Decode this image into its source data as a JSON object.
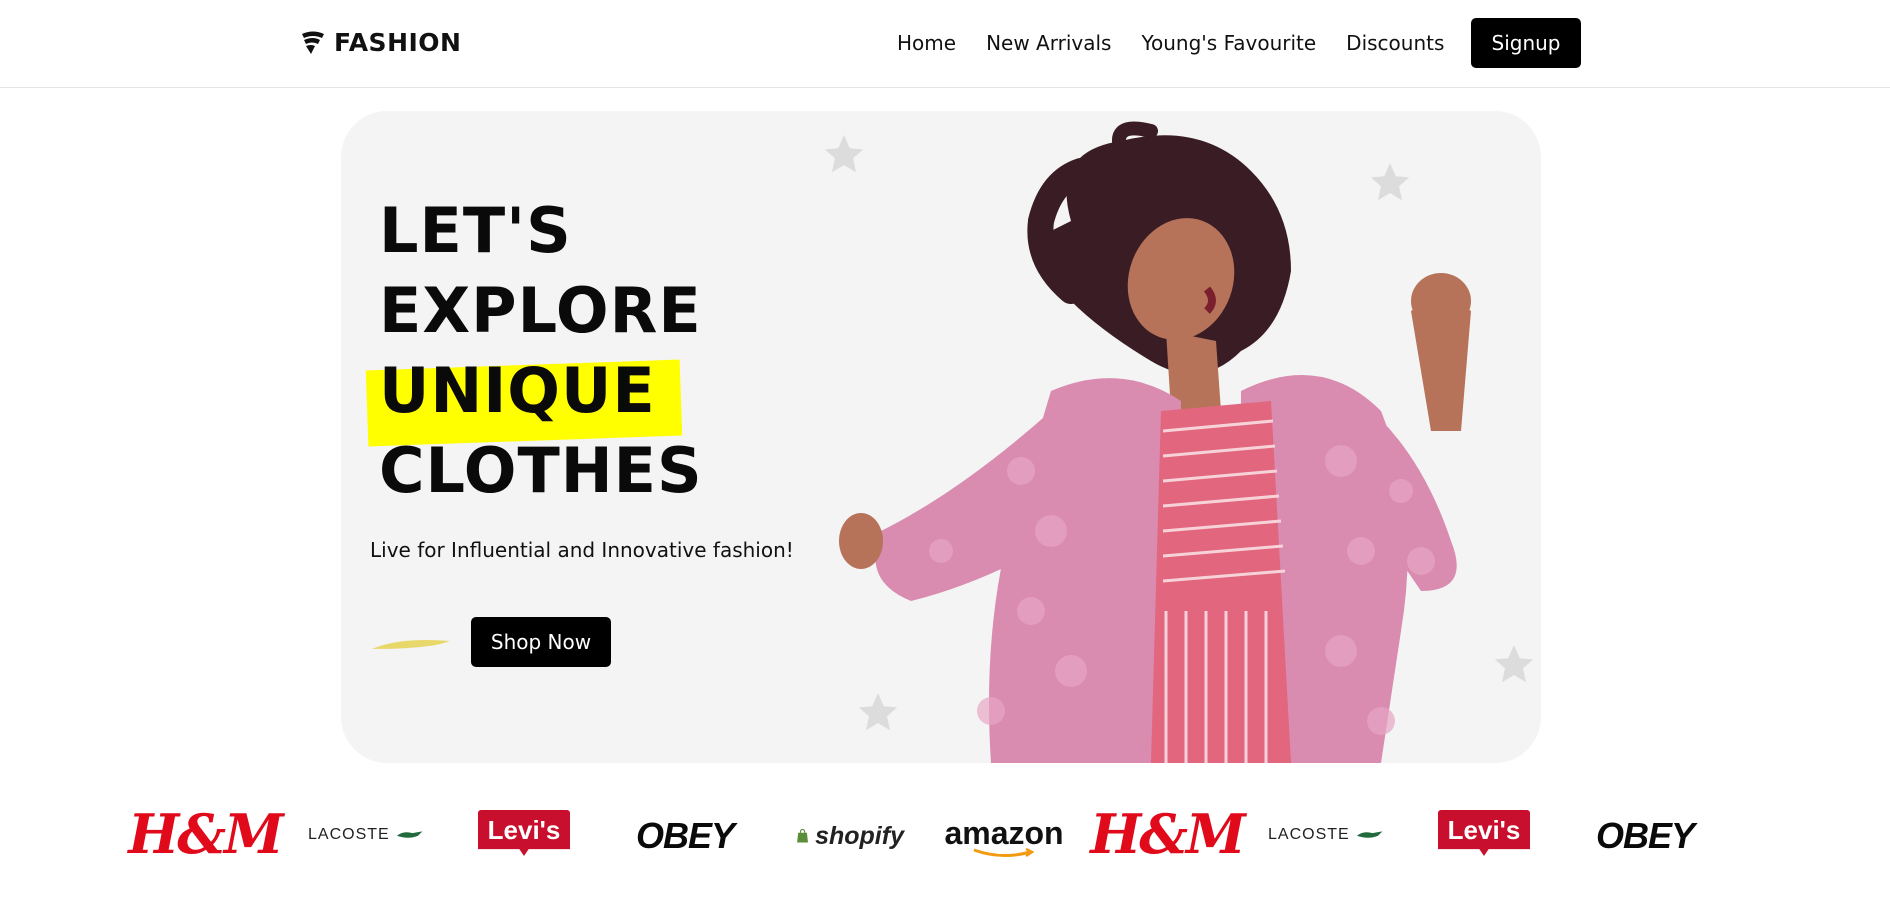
{
  "header": {
    "brand": "FASHION",
    "nav": [
      "Home",
      "New Arrivals",
      "Young's Favourite",
      "Discounts"
    ],
    "signup_label": "Signup"
  },
  "hero": {
    "headline_lines": [
      "LET'S",
      "EXPLORE",
      "UNIQUE",
      "CLOTHES"
    ],
    "highlight_color": "#ffff00",
    "tagline": "Live for Influential and Innovative fashion!",
    "cta_label": "Shop Now",
    "image": "model-dancing-pink-fur-coat"
  },
  "brands": [
    {
      "name": "H&M",
      "text": "H&M"
    },
    {
      "name": "LACOSTE",
      "text": "LACOSTE"
    },
    {
      "name": "Levi's",
      "text": "Levi's"
    },
    {
      "name": "OBEY",
      "text": "OBEY"
    },
    {
      "name": "shopify",
      "text": "shopify"
    },
    {
      "name": "amazon",
      "text": "amazon"
    },
    {
      "name": "H&M",
      "text": "H&M"
    },
    {
      "name": "LACOSTE",
      "text": "LACOSTE"
    },
    {
      "name": "Levi's",
      "text": "Levi's"
    },
    {
      "name": "OBEY",
      "text": "OBEY"
    }
  ],
  "colors": {
    "primary": "#000000",
    "hero_bg": "#f3f4f3",
    "accent_yellow": "#ffff00",
    "swoosh": "#e8d86a"
  }
}
